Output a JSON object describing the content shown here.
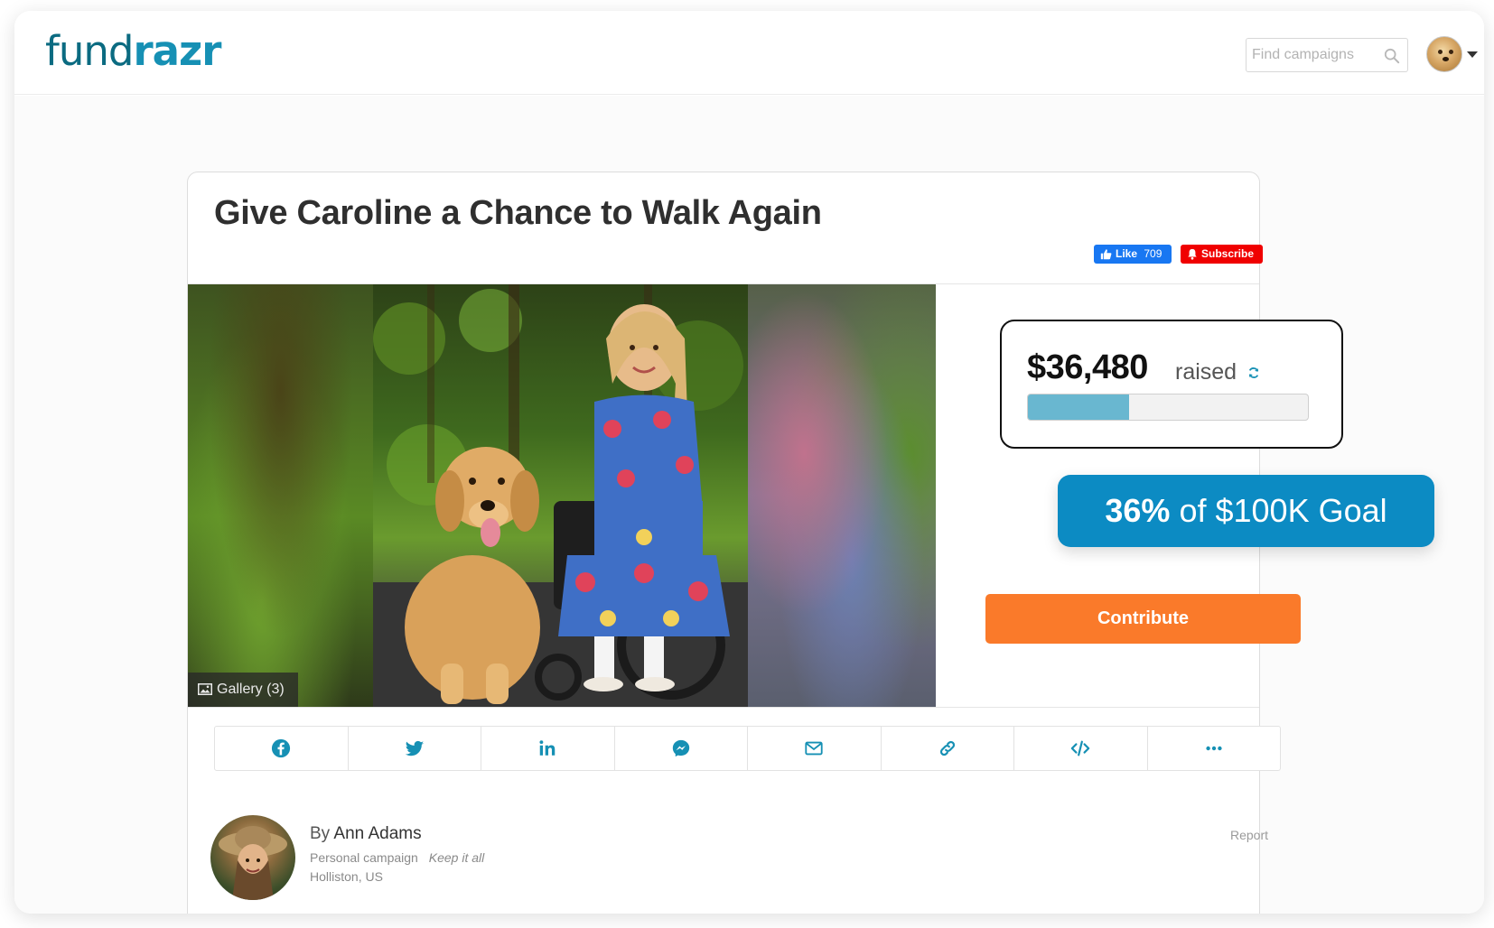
{
  "header": {
    "logo_part1": "fund",
    "logo_part2": "razr",
    "search_placeholder": "Find campaigns",
    "colors": {
      "logo_dark": "#0b6b81",
      "logo_accent": "#1690b4"
    }
  },
  "campaign": {
    "title": "Give Caroline a Chance to Walk Again",
    "social": {
      "like_label": "Like",
      "like_count": "709",
      "subscribe_label": "Subscribe"
    },
    "media": {
      "gallery_label": "Gallery (3)"
    },
    "stats": {
      "amount_raised": "$36,480",
      "raised_label": "raised",
      "progress_fraction": 0.36,
      "goal_percent": "36%",
      "goal_text": "of $100K Goal",
      "colors": {
        "progress": "#69b7d0",
        "goal_pill": "#0c8bc3"
      }
    },
    "contribute_label": "Contribute",
    "contribute_color": "#fa7a2a",
    "share_icons": [
      "facebook-icon",
      "twitter-icon",
      "linkedin-icon",
      "messenger-icon",
      "email-icon",
      "link-icon",
      "embed-code-icon",
      "more-icon"
    ],
    "share_color": "#1690b4",
    "creator": {
      "by_prefix": "By",
      "name": "Ann Adams",
      "campaign_type": "Personal campaign",
      "funding_model": "Keep it all",
      "location": "Holliston, US",
      "report_label": "Report"
    }
  }
}
